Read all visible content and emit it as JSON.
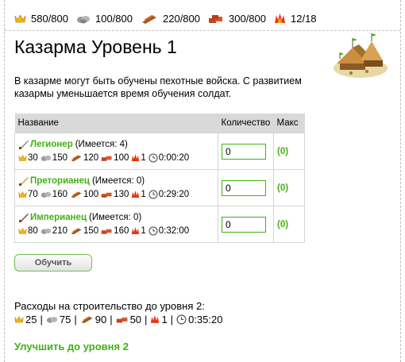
{
  "resources": [
    {
      "icon": "crown-icon",
      "value": "580/800"
    },
    {
      "icon": "stone-icon",
      "value": "100/800"
    },
    {
      "icon": "wood-icon",
      "value": "220/800"
    },
    {
      "icon": "clay-icon",
      "value": "300/800"
    },
    {
      "icon": "spark-icon",
      "value": "12/18"
    }
  ],
  "title": "Казарма Уровень 1",
  "description": "В казарме могут быть обучены пехотные войска. С развитием казармы уменьшается время обучения солдат.",
  "table": {
    "headers": {
      "name": "Название",
      "qty": "Количество",
      "max": "Макс"
    },
    "units": [
      {
        "name": "Легионер",
        "have": "(Имеется: 4)",
        "costs": [
          "30",
          "150",
          "120",
          "100",
          "1"
        ],
        "time": "0:00:20",
        "qty": "0",
        "max": "(0)"
      },
      {
        "name": "Преторианец",
        "have": "(Имеется: 0)",
        "costs": [
          "70",
          "160",
          "100",
          "130",
          "1"
        ],
        "time": "0:29:20",
        "qty": "0",
        "max": "(0)"
      },
      {
        "name": "Империанец",
        "have": "(Имеется: 0)",
        "costs": [
          "80",
          "210",
          "150",
          "160",
          "1"
        ],
        "time": "0:32:00",
        "qty": "0",
        "max": "(0)"
      }
    ]
  },
  "train_button": "Обучить",
  "cost_title": "Расходы на строительство до уровня 2:",
  "cost": {
    "crown": "25",
    "stone": "75",
    "wood": "90",
    "clay": "50",
    "spark": "1",
    "time": "0:35:20"
  },
  "upgrade_link": "Улучшить до уровня 2"
}
